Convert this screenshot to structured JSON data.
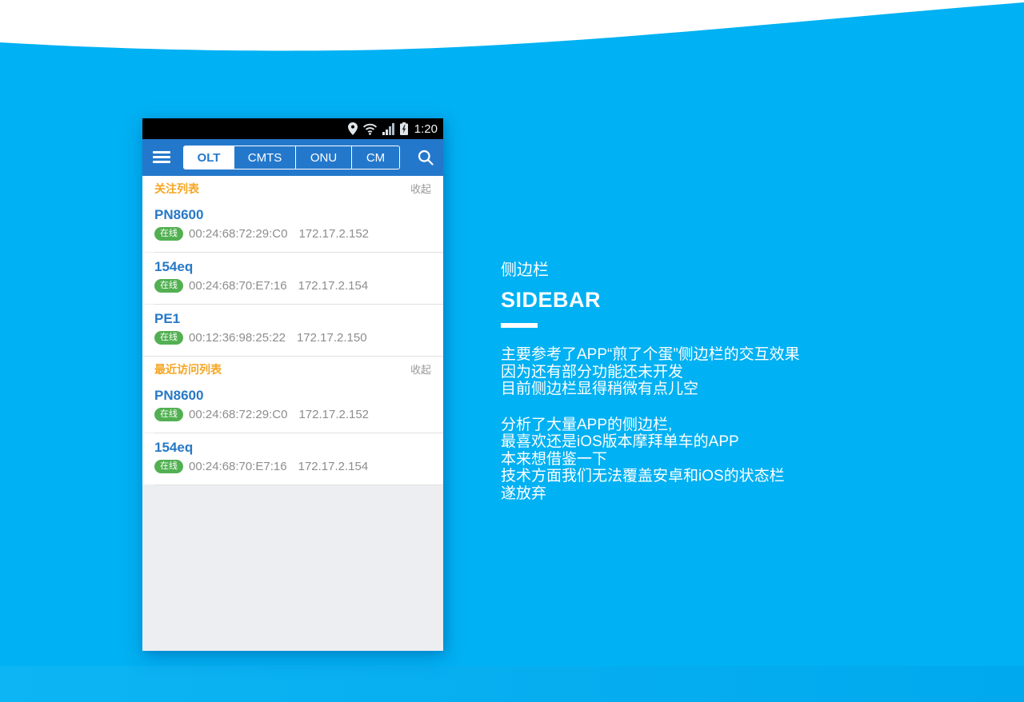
{
  "phone": {
    "status_bar": {
      "time": "1:20",
      "icons": [
        "location-icon",
        "wifi-icon",
        "signal-icon",
        "battery-charging-icon"
      ]
    },
    "toolbar": {
      "menu_icon": "hamburger-icon",
      "search_icon": "search-icon",
      "tabs": [
        {
          "label": "OLT",
          "active": true
        },
        {
          "label": "CMTS",
          "active": false
        },
        {
          "label": "ONU",
          "active": false
        },
        {
          "label": "CM",
          "active": false
        }
      ]
    },
    "sections": [
      {
        "title": "关注列表",
        "collapse_label": "收起",
        "devices": [
          {
            "name": "PN8600",
            "status": "在线",
            "mac": "00:24:68:72:29:C0",
            "ip": "172.17.2.152"
          },
          {
            "name": "154eq",
            "status": "在线",
            "mac": "00:24:68:70:E7:16",
            "ip": "172.17.2.154"
          },
          {
            "name": "PE1",
            "status": "在线",
            "mac": "00:12:36:98:25:22",
            "ip": "172.17.2.150"
          }
        ]
      },
      {
        "title": "最近访问列表",
        "collapse_label": "收起",
        "devices": [
          {
            "name": "PN8600",
            "status": "在线",
            "mac": "00:24:68:72:29:C0",
            "ip": "172.17.2.152"
          },
          {
            "name": "154eq",
            "status": "在线",
            "mac": "00:24:68:70:E7:16",
            "ip": "172.17.2.154"
          }
        ]
      }
    ]
  },
  "annotation": {
    "subtitle": "侧边栏",
    "title": "SIDEBAR",
    "paragraphs": [
      [
        "主要参考了APP“煎了个蛋”侧边栏的交互效果",
        "因为还有部分功能还未开发",
        "目前侧边栏显得稍微有点儿空"
      ],
      [
        "分析了大量APP的侧边栏,",
        "最喜欢还是iOS版本摩拜单车的APP",
        "本来想借鉴一下",
        "技术方面我们无法覆盖安卓和iOS的状态栏",
        "遂放弃"
      ]
    ]
  },
  "colors": {
    "canvas_cyan": "#00b1f3",
    "toolbar_blue": "#2478cb",
    "accent_orange": "#f5a623",
    "online_green": "#52b052",
    "device_name_blue": "#2779c7",
    "muted_gray": "#8d8d8d",
    "list_bg_gray": "#eceef1",
    "status_bar_black": "#000000",
    "annotation_white": "#ffffff"
  }
}
